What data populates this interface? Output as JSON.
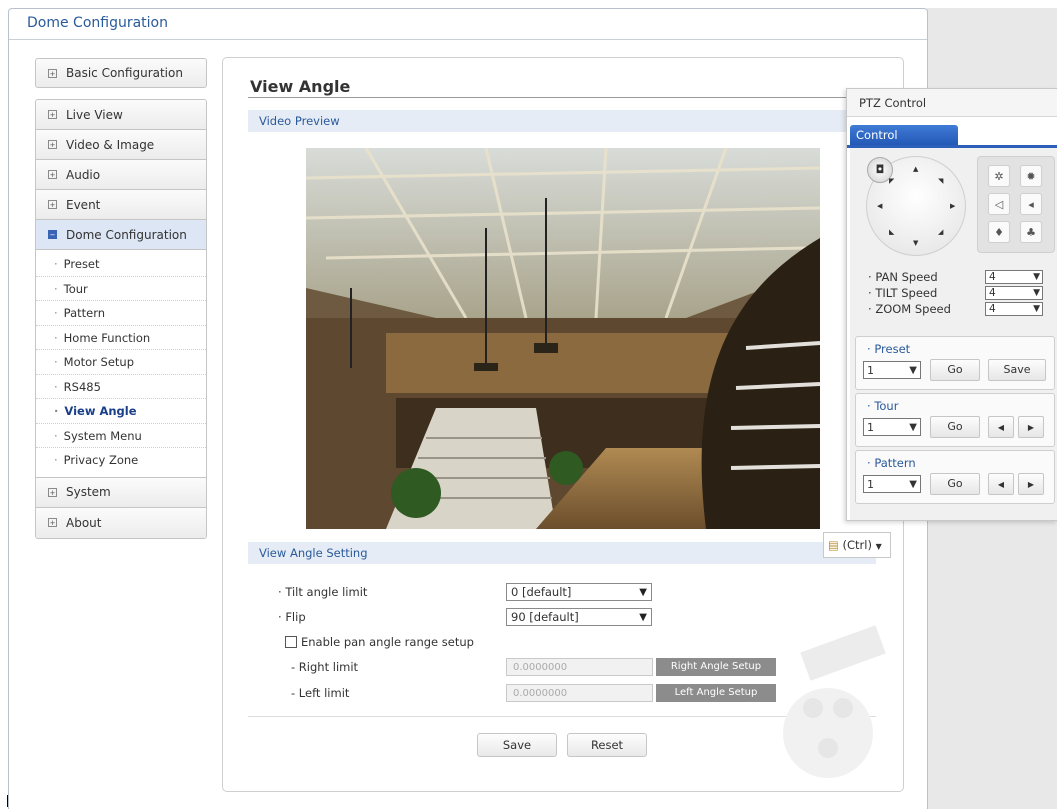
{
  "window": {
    "title": "Dome Configuration"
  },
  "sidebar": {
    "basic": "Basic Configuration",
    "items": [
      "Live View",
      "Video & Image",
      "Audio",
      "Event"
    ],
    "active_group": "Dome Configuration",
    "sub_items": [
      "Preset",
      "Tour",
      "Pattern",
      "Home Function",
      "Motor Setup",
      "RS485",
      "View Angle",
      "System Menu",
      "Privacy Zone"
    ],
    "selected_sub": "View Angle",
    "bottom_items": [
      "System",
      "About"
    ]
  },
  "page": {
    "title": "View Angle",
    "video_section": "Video Preview",
    "setting_section": "View Angle Setting",
    "tilt_label": "Tilt angle limit",
    "tilt_value": "0   [default]",
    "flip_label": "Flip",
    "flip_value": "90  [default]",
    "pan_checkbox_label": "Enable pan angle range setup",
    "right_limit_label": "- Right limit",
    "right_limit_value": "0.0000000",
    "right_button": "Right Angle Setup",
    "left_limit_label": "- Left limit",
    "left_limit_value": "0.0000000",
    "left_button": "Left Angle Setup",
    "save": "Save",
    "reset": "Reset",
    "ctrl_popup": "(Ctrl)"
  },
  "ptz": {
    "title": "PTZ Control",
    "tab": "Control",
    "pan_label": "PAN Speed",
    "pan_value": "4",
    "tilt_label": "TILT Speed",
    "tilt_value": "4",
    "zoom_label": "ZOOM Speed",
    "zoom_value": "4",
    "preset_title": "Preset",
    "preset_value": "1",
    "tour_title": "Tour",
    "tour_value": "1",
    "pattern_title": "Pattern",
    "pattern_value": "1",
    "go": "Go",
    "save": "Save"
  },
  "colors": {
    "accent": "#2a5a9a",
    "tab_blue": "#2b5fba",
    "section_bg": "#e6ecf6"
  }
}
